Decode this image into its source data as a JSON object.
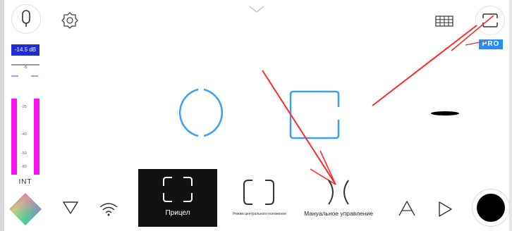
{
  "audio": {
    "level": "-14.5 dB",
    "scale_value": "-5"
  },
  "meters": {
    "ticks": [
      "-25",
      "-40",
      "-50",
      "-60"
    ],
    "input_label": "INT"
  },
  "topbar": {
    "pro_badge": "PRO"
  },
  "modes": {
    "items": [
      {
        "label": "Прицел",
        "selected": true
      },
      {
        "label": "Режим центрального положения",
        "selected": false
      },
      {
        "label": "Мануальное управление",
        "selected": false
      }
    ]
  },
  "colors": {
    "accent_blue": "#3aa0f5",
    "level_meter": "#ff10f0",
    "db_badge": "#1f2bd6",
    "pro_badge": "#1e90ff",
    "annotation_arrow": "#ff2a2a"
  },
  "icons": {
    "mic": "mic-icon",
    "settings": "settings-icon",
    "collapse": "chevron-down-icon",
    "grid": "grid-icon",
    "frame": "frame-icon",
    "color": "color-wheel-icon",
    "gesture": "gesture-icon",
    "wifi": "wifi-icon",
    "text": "text-icon",
    "play": "play-icon"
  }
}
